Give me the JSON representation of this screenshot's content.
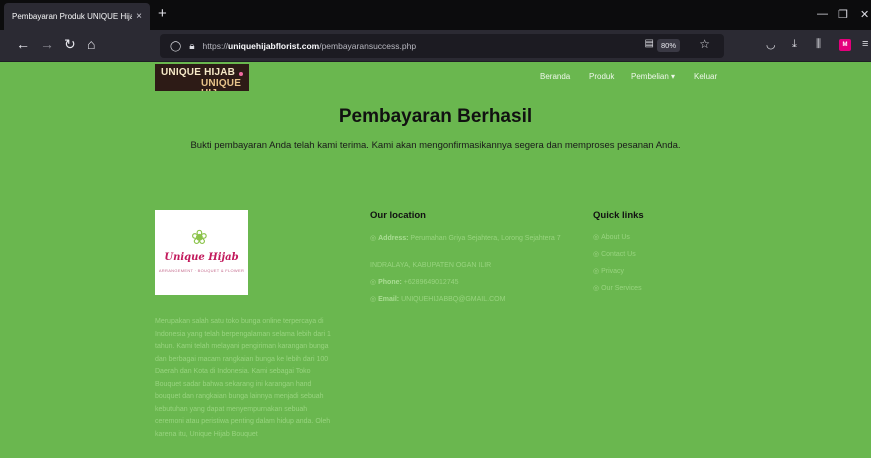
{
  "browser": {
    "tab_title": "Pembayaran Produk UNIQUE Hijab",
    "tab_close": "×",
    "new_tab": "+",
    "url_prefix": "https://",
    "url_host": "uniquehijabflorist.com",
    "url_path": "/pembayaransuccess.php",
    "zoom": "80%",
    "window_controls": [
      "—",
      "❐",
      "✕"
    ],
    "extension_badge": "M"
  },
  "header": {
    "logo_line1": "UNIQUE HIJAB",
    "logo_line2": "UNIQUE HIJ",
    "menu": [
      "Beranda",
      "Produk",
      "Pembelian ▾",
      "Keluar"
    ]
  },
  "main": {
    "title": "Pembayaran Berhasil",
    "message": "Bukti pembayaran Anda telah kami terima. Kami akan mengonfirmasikannya segera dan memproses pesanan Anda."
  },
  "footer": {
    "card_brand": "Unique Hijab",
    "card_tag": "ARRANGEMENT · BOUQUET & FLOWER",
    "about": "Merupakan salah satu toko bunga online terpercaya di Indonesia yang telah berpengalaman selama lebih dari 1 tahun. Kami telah melayani pengiriman karangan bunga dan berbagai macam rangkaian bunga ke lebih dari 100 Daerah dan Kota di Indonesia. Kami sebagai Toko Bouquet sadar bahwa sekarang ini karangan hand bouquet dan rangkaian bunga lainnya menjadi sebuah kebutuhan yang dapat menyempurnakan sebuah ceremoni atau peristiwa penting dalam hidup anda. Oleh karena itu, Unique Hijab Bouquet",
    "location_title": "Our location",
    "address_label": "Address:",
    "address_value": "Perumahan Griya Sejahtera, Lorong Sejahtera 7",
    "address_city": "INDRALAYA, KABUPATEN OGAN ILIR",
    "phone_label": "Phone:",
    "phone_value": "+6289649012745",
    "email_label": "Email:",
    "email_value": "UNIQUEHIJABBQ@GMAIL.COM",
    "quick_title": "Quick links",
    "quick_links": [
      "About Us",
      "Contact Us",
      "Privacy",
      "Our Services"
    ]
  }
}
